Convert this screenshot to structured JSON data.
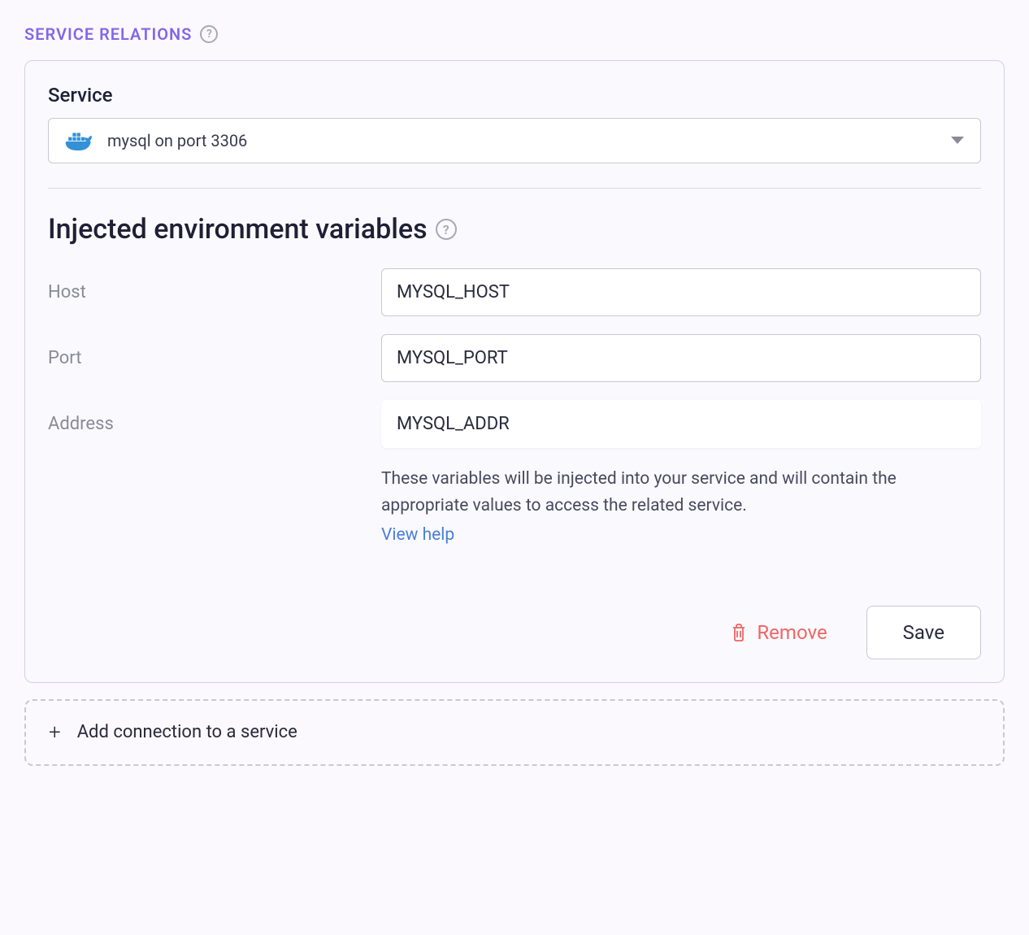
{
  "section": {
    "title": "SERVICE RELATIONS"
  },
  "service": {
    "label": "Service",
    "selected": "mysql on port 3306",
    "icon": "docker-icon"
  },
  "envvars": {
    "title": "Injected environment variables",
    "fields": {
      "host": {
        "label": "Host",
        "value": "MYSQL_HOST"
      },
      "port": {
        "label": "Port",
        "value": "MYSQL_PORT"
      },
      "address": {
        "label": "Address",
        "value": "MYSQL_ADDR"
      }
    },
    "help_text": "These variables will be injected into your service and will contain the appropriate values to access the related service.",
    "help_link": "View help"
  },
  "buttons": {
    "remove": "Remove",
    "save": "Save"
  },
  "add_connection": {
    "label": "Add connection to a service"
  }
}
